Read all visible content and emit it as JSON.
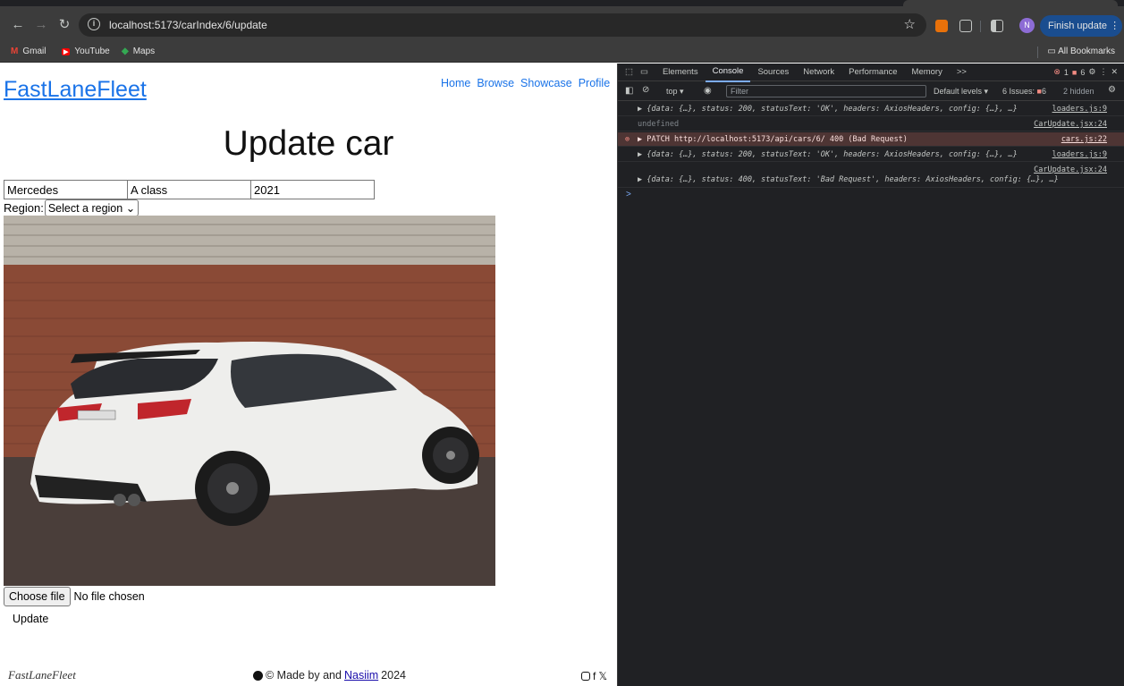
{
  "browser": {
    "url": "localhost:5173/carIndex/6/update",
    "finish_update": "Finish update",
    "avatar_letter": "N",
    "bookmarks": [
      "Gmail",
      "YouTube",
      "Maps"
    ],
    "all_bookmarks": "All Bookmarks"
  },
  "site": {
    "logo": "FastLaneFleet",
    "nav": [
      "Home",
      "Browse",
      "Showcase",
      "Profile"
    ],
    "title": "Update car",
    "make_value": "Mercedes",
    "model_value": "A class",
    "year_value": "2021",
    "region_label": "Region:",
    "region_select": "Select a region",
    "choose_file": "Choose file",
    "no_file": "No file chosen",
    "update_label": "Update",
    "footer_logo": "FastLaneFleet",
    "footer_credit_prefix": "© Made by and",
    "footer_credit_link": "Nasiim",
    "footer_credit_suffix": "2024"
  },
  "devtools": {
    "tabs": [
      "Elements",
      "Console",
      "Sources",
      "Network",
      "Performance",
      "Memory"
    ],
    "more": ">>",
    "errors_count": "1",
    "warnings_count": "6",
    "context": "top",
    "filter_placeholder": "Filter",
    "levels": "Default levels",
    "issues_label": "6 Issues:",
    "issues_count": "6",
    "hidden": "2 hidden",
    "messages": [
      {
        "text": "▶ {data: {…}, status: 200, statusText: 'OK', headers: AxiosHeaders, config: {…}, …}",
        "source": "loaders.js:9"
      },
      {
        "text": "undefined",
        "source": "CarUpdate.jsx:24"
      },
      {
        "text": "▶ PATCH http://localhost:5173/api/cars/6/ 400 (Bad Request)",
        "source": "cars.js:22"
      },
      {
        "text": "▶ {data: {…}, status: 200, statusText: 'OK', headers: AxiosHeaders, config: {…}, …}",
        "source": "loaders.js:9"
      },
      {
        "text": "▶ {data: {…}, status: 400, statusText: 'Bad Request', headers: AxiosHeaders, config: {…}, …}",
        "source": "CarUpdate.jsx:24"
      }
    ],
    "prompt": ">"
  },
  "colors": {
    "link": "#1a73e8",
    "chrome_bg": "#3c3c3c",
    "devtools_bg": "#202124",
    "error_row": "#4e3534"
  }
}
